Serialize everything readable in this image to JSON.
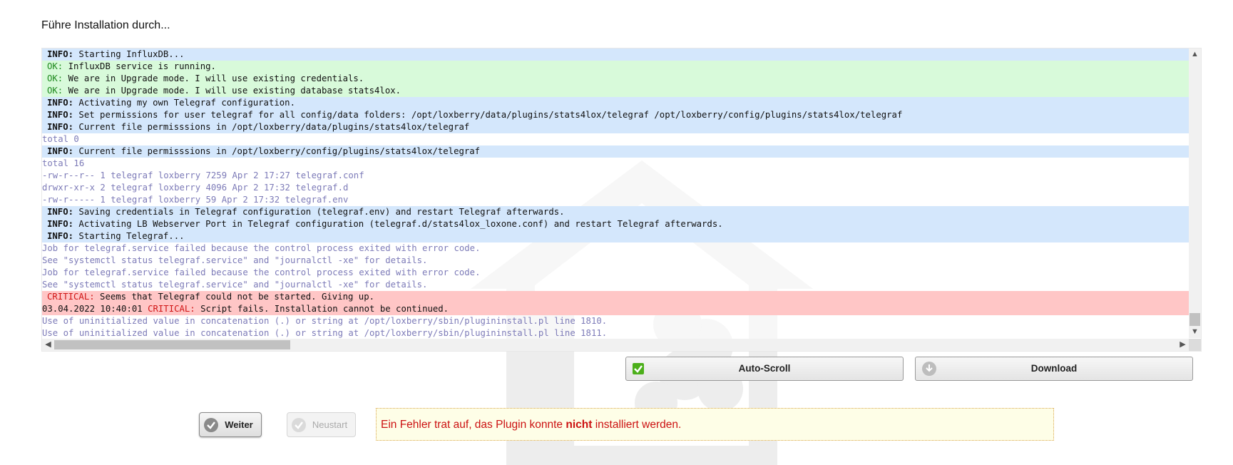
{
  "page": {
    "title": "Führe Installation durch..."
  },
  "colors": {
    "info_bg": "#d2e6fc",
    "ok_bg": "#d6fad8",
    "critical_bg": "#ffc4c4",
    "plain_text": "#7d7bb8",
    "ok_text": "#1f8a1f",
    "critical_text": "#d01515",
    "error_text": "#cc1111",
    "error_box_bg": "#fefee7"
  },
  "log": {
    "lines": [
      {
        "type": "info",
        "prefix": "",
        "level": "INFO:",
        "text": " Starting InfluxDB..."
      },
      {
        "type": "ok",
        "prefix": "",
        "level": "OK:",
        "text": " InfluxDB service is running."
      },
      {
        "type": "ok",
        "prefix": "",
        "level": "OK:",
        "text": " We are in Upgrade mode. I will use existing credentials."
      },
      {
        "type": "ok",
        "prefix": "",
        "level": "OK:",
        "text": " We are in Upgrade mode. I will use existing database stats4lox."
      },
      {
        "type": "info",
        "prefix": "",
        "level": "INFO:",
        "text": " Activating my own Telegraf configuration."
      },
      {
        "type": "info",
        "prefix": "",
        "level": "INFO:",
        "text": " Set permissions for user telegraf for all config/data folders: /opt/loxberry/data/plugins/stats4lox/telegraf /opt/loxberry/config/plugins/stats4lox/telegraf"
      },
      {
        "type": "info",
        "prefix": "",
        "level": "INFO:",
        "text": " Current file permisssions in /opt/loxberry/data/plugins/stats4lox/telegraf"
      },
      {
        "type": "plain",
        "prefix": "",
        "level": "",
        "text": "total 0"
      },
      {
        "type": "info",
        "prefix": "",
        "level": "INFO:",
        "text": " Current file permisssions in /opt/loxberry/config/plugins/stats4lox/telegraf"
      },
      {
        "type": "plain",
        "prefix": "",
        "level": "",
        "text": "total 16"
      },
      {
        "type": "plain",
        "prefix": "",
        "level": "",
        "text": "-rw-r--r-- 1 telegraf loxberry 7259 Apr 2 17:27 telegraf.conf"
      },
      {
        "type": "plain",
        "prefix": "",
        "level": "",
        "text": "drwxr-xr-x 2 telegraf loxberry 4096 Apr 2 17:32 telegraf.d"
      },
      {
        "type": "plain",
        "prefix": "",
        "level": "",
        "text": "-rw-r----- 1 telegraf loxberry 59 Apr 2 17:32 telegraf.env"
      },
      {
        "type": "info",
        "prefix": "",
        "level": "INFO:",
        "text": " Saving credentials in Telegraf configuration (telegraf.env) and restart Telegraf afterwards."
      },
      {
        "type": "info",
        "prefix": "",
        "level": "INFO:",
        "text": " Activating LB Webserver Port in Telegraf configuration (telegraf.d/stats4lox_loxone.conf) and restart Telegraf afterwards."
      },
      {
        "type": "info",
        "prefix": "",
        "level": "INFO:",
        "text": " Starting Telegraf..."
      },
      {
        "type": "plain",
        "prefix": "",
        "level": "",
        "text": "Job for telegraf.service failed because the control process exited with error code."
      },
      {
        "type": "plain",
        "prefix": "",
        "level": "",
        "text": "See \"systemctl status telegraf.service\" and \"journalctl -xe\" for details."
      },
      {
        "type": "plain",
        "prefix": "",
        "level": "",
        "text": "Job for telegraf.service failed because the control process exited with error code."
      },
      {
        "type": "plain",
        "prefix": "",
        "level": "",
        "text": "See \"systemctl status telegraf.service\" and \"journalctl -xe\" for details."
      },
      {
        "type": "crit",
        "prefix": "",
        "level": "CRITICAL:",
        "text": " Seems that Telegraf could not be started. Giving up."
      },
      {
        "type": "crit dated",
        "prefix": "03.04.2022 10:40:01 ",
        "level": "CRITICAL:",
        "text": " Script fails. Installation cannot be continued."
      },
      {
        "type": "plain",
        "prefix": "",
        "level": "",
        "text": "Use of uninitialized value in concatenation (.) or string at /opt/loxberry/sbin/plugininstall.pl line 1810."
      },
      {
        "type": "plain",
        "prefix": "",
        "level": "",
        "text": "Use of uninitialized value in concatenation (.) or string at /opt/loxberry/sbin/plugininstall.pl line 1811."
      }
    ]
  },
  "toolbar": {
    "autoscroll_label": "Auto-Scroll",
    "autoscroll_checked": true,
    "download_label": "Download"
  },
  "actions": {
    "weiter_label": "Weiter",
    "neustart_label": "Neustart"
  },
  "error": {
    "text_before": "Ein Fehler trat auf, das Plugin konnte ",
    "text_bold": "nicht",
    "text_after": " installiert werden."
  },
  "icons": {
    "autoscroll": "checkbox-checked-icon",
    "download": "download-arrow-icon",
    "weiter": "check-circle-icon",
    "neustart": "check-circle-icon",
    "watermark": "loxberry-logo-icon"
  }
}
